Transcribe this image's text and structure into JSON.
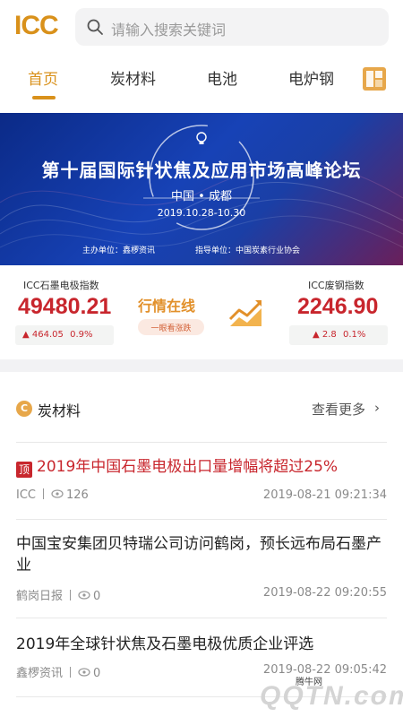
{
  "app": {
    "logo": "ICC"
  },
  "search": {
    "placeholder": "请输入搜索关键词"
  },
  "tabs": [
    {
      "label": "首页",
      "active": true
    },
    {
      "label": "炭材料"
    },
    {
      "label": "电池"
    },
    {
      "label": "电炉钢"
    }
  ],
  "banner": {
    "title": "第十届国际针状焦及应用市场高峰论坛",
    "location": "中国 • 成都",
    "date": "2019.10.28-10.30",
    "organizer": "主办单位：鑫椤资讯",
    "guide": "指导单位：中国炭素行业协会"
  },
  "indices": {
    "left": {
      "label": "ICC石墨电极指数",
      "value": "49480.21",
      "change": "464.05",
      "pct": "0.9%"
    },
    "center": {
      "title": "行情在线",
      "subtitle": "一眼看涨跌"
    },
    "right": {
      "label": "ICC废钢指数",
      "value": "2246.90",
      "change": "2.8",
      "pct": "0.1%"
    }
  },
  "section": {
    "title": "炭材料",
    "more": "查看更多",
    "icon_letter": "C"
  },
  "articles": [
    {
      "badge": "顶",
      "title": "2019年中国石墨电极出口量增幅将超过25%",
      "source": "ICC",
      "views": "126",
      "time": "2019-08-21 09:21:34"
    },
    {
      "title": "中国宝安集团贝特瑞公司访问鹤岗，预长远布局石墨产业",
      "source": "鹤岗日报",
      "views": "0",
      "time": "2019-08-22 09:20:55"
    },
    {
      "title": "2019年全球针状焦及石墨电极优质企业评选",
      "source": "鑫椤资讯",
      "views": "0",
      "time": "2019-08-22 09:05:42"
    }
  ],
  "watermark": {
    "site": "腾牛网",
    "brand": "QQTN.com"
  },
  "colors": {
    "accent": "#d9911b",
    "red": "#c8262d",
    "banner_blue": "#1742b6"
  }
}
